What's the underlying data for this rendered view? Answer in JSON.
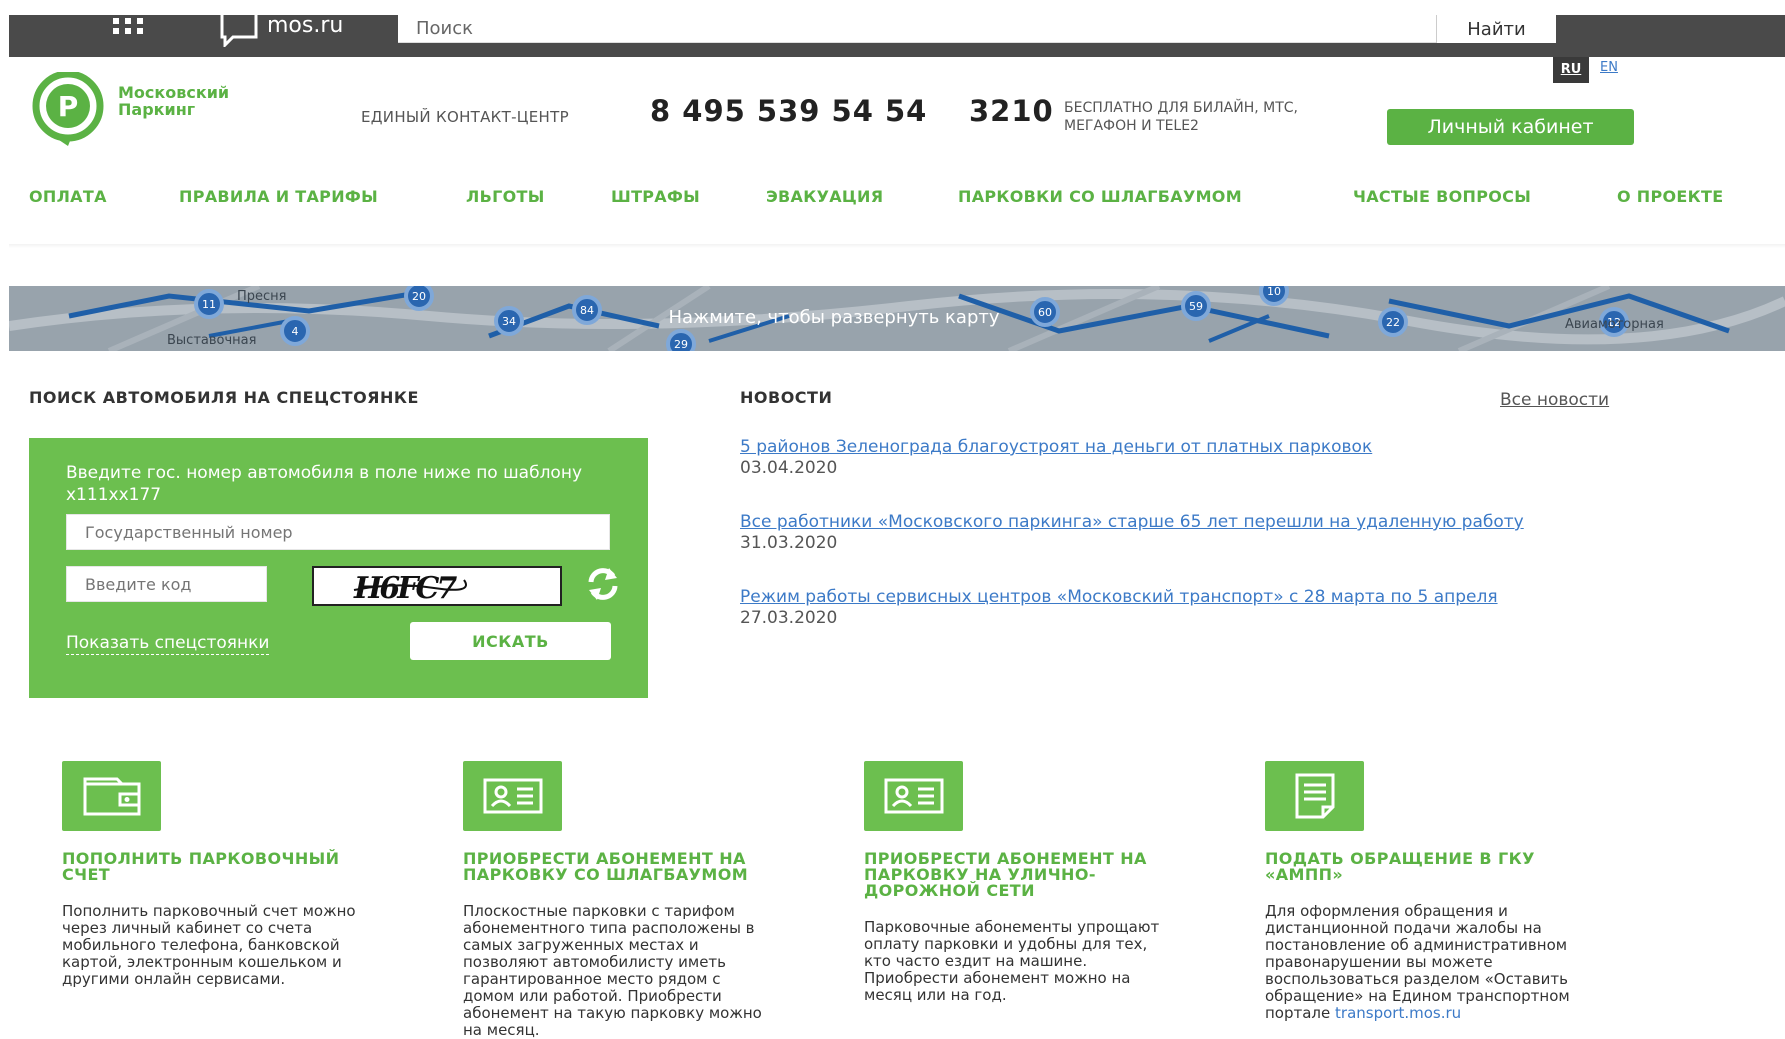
{
  "topbar": {
    "portal_name": "mos.ru",
    "search_placeholder": "Поиск",
    "search_button": "Найти"
  },
  "header": {
    "brand_line1": "Московский",
    "brand_line2": "Паркинг",
    "contact_label": "ЕДИНЫЙ КОНТАКТ-ЦЕНТР",
    "phone_main": "8 495 539 54 54",
    "phone_short": "3210",
    "phone_note": "БЕСПЛАТНО ДЛЯ БИЛАЙН, МТС, МЕГАФОН И TELE2",
    "lang_ru": "RU",
    "lang_en": "EN",
    "cabinet_button": "Личный кабинет"
  },
  "nav": {
    "items": [
      {
        "label": "ОПЛАТА"
      },
      {
        "label": "ПРАВИЛА И ТАРИФЫ"
      },
      {
        "label": "ЛЬГОТЫ"
      },
      {
        "label": "ШТРАФЫ"
      },
      {
        "label": "ЭВАКУАЦИЯ"
      },
      {
        "label": "ПАРКОВКИ СО ШЛАГБАУМОМ"
      },
      {
        "label": "ЧАСТЫЕ ВОПРОСЫ"
      },
      {
        "label": "О ПРОЕКТЕ"
      }
    ]
  },
  "map": {
    "cta": "Нажмите, чтобы развернуть карту",
    "cluster_counts": [
      "11",
      "20",
      "34",
      "84",
      "4",
      "29",
      "60",
      "59",
      "10",
      "22",
      "12"
    ],
    "place_names": [
      "Пресня",
      "Выставочная",
      "Авиамоторная"
    ]
  },
  "search_section": {
    "title": "ПОИСК АВТОМОБИЛЯ НА СПЕЦСТОЯНКЕ",
    "hint": "Введите гос. номер автомобиля в поле ниже по шаблону х111хх177",
    "plate_placeholder": "Государственный номер",
    "code_placeholder": "Введите код",
    "captcha_text": "H6FC7",
    "show_lots_link": "Показать спецстоянки",
    "search_button": "ИСКАТЬ"
  },
  "news_section": {
    "title": "НОВОСТИ",
    "all_news": "Все новости",
    "items": [
      {
        "title": "5 районов Зеленограда благоустроят на деньги от платных парковок",
        "date": "03.04.2020"
      },
      {
        "title": "Все работники «Московского паркинга» старше 65 лет перешли на удаленную работу",
        "date": "31.03.2020"
      },
      {
        "title": "Режим работы сервисных центров «Московский транспорт» с 28 марта по 5 апреля",
        "date": "27.03.2020"
      }
    ]
  },
  "services": [
    {
      "icon": "wallet-icon",
      "title": "ПОПОЛНИТЬ ПАРКОВОЧНЫЙ СЧЕТ",
      "text": "Пополнить парковочный счет можно через личный кабинет со счета мобильного телефона, банковской картой, электронным кошельком и другими онлайн сервисами."
    },
    {
      "icon": "id-card-icon",
      "title": "ПРИОБРЕСТИ АБОНЕМЕНТ НА ПАРКОВКУ СО ШЛАГБАУМОМ",
      "text": "Плоскостные парковки с тарифом абонементного типа расположены в самых загруженных местах и позволяют автомобилисту иметь гарантированное место рядом с домом или работой. Приобрести абонемент на такую парковку можно на месяц."
    },
    {
      "icon": "id-card-icon",
      "title": "ПРИОБРЕСТИ АБОНЕМЕНТ НА ПАРКОВКУ НА УЛИЧНО-ДОРОЖНОЙ СЕТИ",
      "text": "Парковочные абонементы упрощают оплату парковки и удобны для тех, кто часто ездит на машине. Приобрести абонемент можно на месяц или на год."
    },
    {
      "icon": "document-icon",
      "title": "ПОДАТЬ ОБРАЩЕНИЕ В ГКУ «АМПП»",
      "text": "Для оформления обращения и дистанционной подачи жалобы на постановление об административном правонарушении вы можете воспользоваться разделом «Оставить обращение» на Едином транспортном портале",
      "link": "transport.mos.ru"
    }
  ],
  "colors": {
    "brand_green": "#5bb244",
    "panel_green": "#6cbf4f",
    "link_blue": "#3c7ac7",
    "topbar": "#4a4a4a"
  }
}
